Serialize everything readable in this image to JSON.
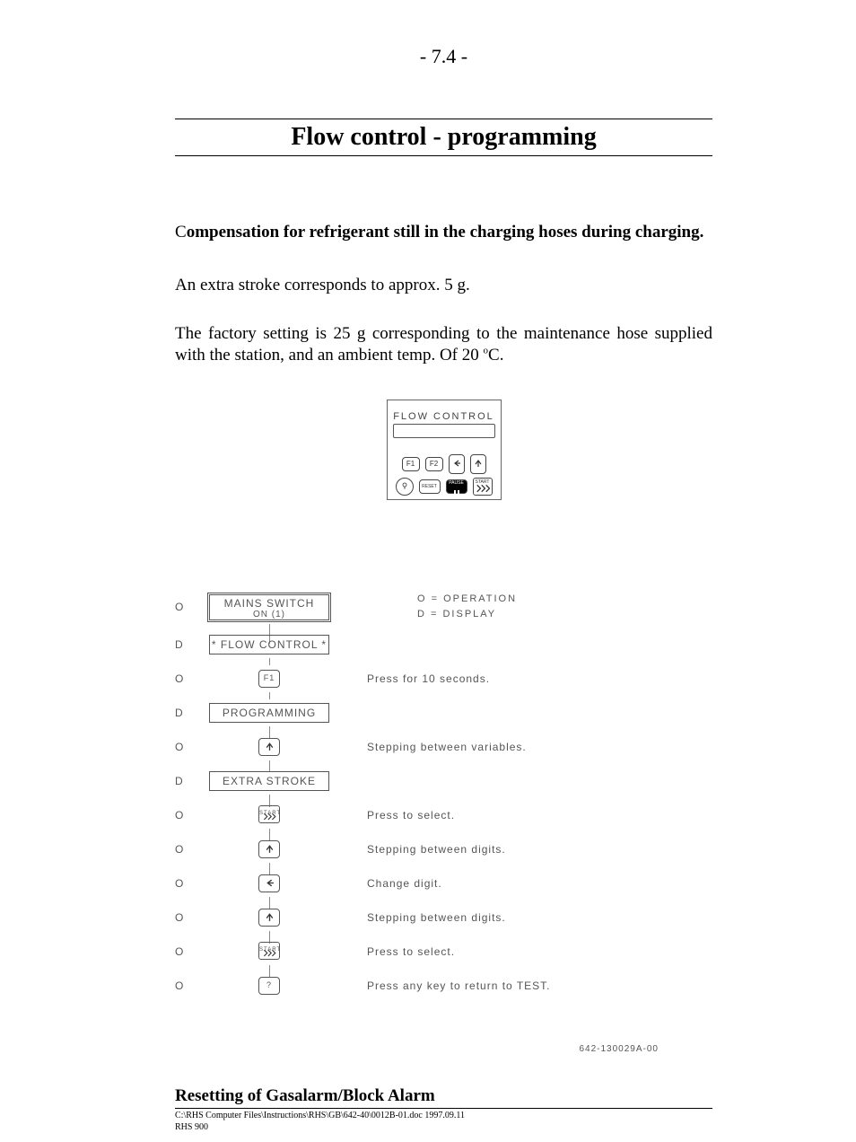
{
  "pageNumber": "- 7.4 -",
  "title": "Flow control - programming",
  "subtitle": "Compensation for refrigerant still in the charging hoses during charging.",
  "para1": "An extra stroke corresponds to approx. 5 g.",
  "para2a": "The factory setting is 25 g corresponding to the maintenance hose supplied with the station, and an ambient temp. Of 20 ",
  "para2b": "C.",
  "panel": {
    "lcd": "FLOW CONTROL",
    "keys": {
      "f1": "F1",
      "f2": "F2",
      "left": "←",
      "up": "↑",
      "light": "light-icon",
      "reset": "RESET",
      "pause": "PAUSE",
      "start": "START"
    }
  },
  "legend": {
    "o": "O = OPERATION",
    "d": "D = DISPLAY"
  },
  "flow": [
    {
      "tag": "O",
      "type": "box-double",
      "text": "MAINS SWITCH",
      "sub": "ON (1)",
      "note": ""
    },
    {
      "tag": "D",
      "type": "box",
      "text": "* FLOW CONTROL *",
      "note": ""
    },
    {
      "tag": "O",
      "type": "key-text",
      "key": "F1",
      "note": "Press for 10 seconds."
    },
    {
      "tag": "D",
      "type": "box",
      "text": "PROGRAMMING",
      "note": ""
    },
    {
      "tag": "O",
      "type": "key-up",
      "note": "Stepping between variables."
    },
    {
      "tag": "D",
      "type": "box",
      "text": "EXTRA STROKE",
      "note": ""
    },
    {
      "tag": "O",
      "type": "key-start",
      "key": "START",
      "note": "Press to select."
    },
    {
      "tag": "O",
      "type": "key-up",
      "note": "Stepping between digits."
    },
    {
      "tag": "O",
      "type": "key-left",
      "note": "Change digit."
    },
    {
      "tag": "O",
      "type": "key-up",
      "note": "Stepping between digits."
    },
    {
      "tag": "O",
      "type": "key-start",
      "key": "START",
      "note": "Press to select."
    },
    {
      "tag": "O",
      "type": "key-text",
      "key": "?",
      "note": "Press any key to return to TEST."
    }
  ],
  "drawingId": "642-130029A-00",
  "section2": "Resetting of Gasalarm/Block Alarm",
  "footer": {
    "line1": "C:\\RHS Computer Files\\Instructions\\RHS\\GB\\642-40\\0012B-01.doc   1997.09.11",
    "line2": "RHS 900"
  }
}
